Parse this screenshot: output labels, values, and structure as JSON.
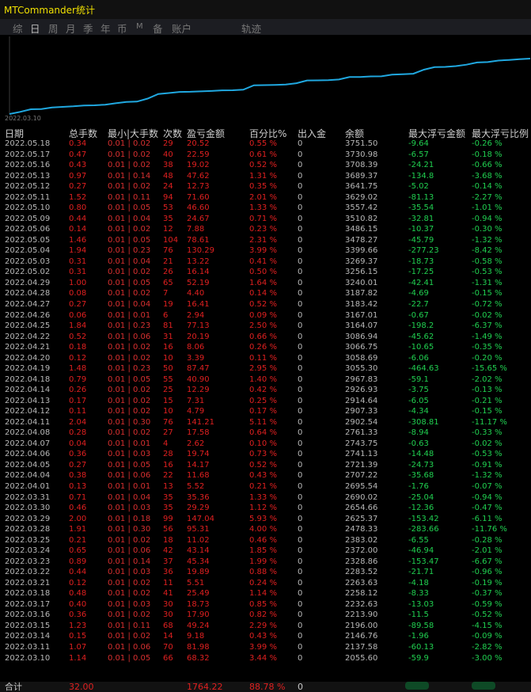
{
  "window": {
    "title": "MTCommander统计"
  },
  "tabs": [
    "综",
    "日",
    "周",
    "月",
    "季",
    "年",
    "币",
    "M",
    "备",
    "账户",
    "轨迹"
  ],
  "active_tab": "日",
  "chart": {
    "start_label": "2022.03.10",
    "line_color": "#20a8e0"
  },
  "columns": [
    "日期",
    "总手数",
    "最小|大手数",
    "次数",
    "盈亏金额",
    "百分比%",
    "出入金",
    "余额",
    "最大浮亏金额",
    "最大浮亏比例"
  ],
  "rows": [
    [
      "2022.05.18",
      "0.34",
      "0.01 | 0.02",
      "29",
      "20.52",
      "0.55 %",
      "0",
      "3751.50",
      "-9.64",
      "-0.26 %"
    ],
    [
      "2022.05.17",
      "0.47",
      "0.01 | 0.02",
      "40",
      "22.59",
      "0.61 %",
      "0",
      "3730.98",
      "-6.57",
      "-0.18 %"
    ],
    [
      "2022.05.16",
      "0.43",
      "0.01 | 0.02",
      "38",
      "19.02",
      "0.52 %",
      "0",
      "3708.39",
      "-24.21",
      "-0.66 %"
    ],
    [
      "2022.05.13",
      "0.97",
      "0.01 | 0.14",
      "48",
      "47.62",
      "1.31 %",
      "0",
      "3689.37",
      "-134.8",
      "-3.68 %"
    ],
    [
      "2022.05.12",
      "0.27",
      "0.01 | 0.02",
      "24",
      "12.73",
      "0.35 %",
      "0",
      "3641.75",
      "-5.02",
      "-0.14 %"
    ],
    [
      "2022.05.11",
      "1.52",
      "0.01 | 0.11",
      "94",
      "71.60",
      "2.01 %",
      "0",
      "3629.02",
      "-81.13",
      "-2.27 %"
    ],
    [
      "2022.05.10",
      "0.80",
      "0.01 | 0.05",
      "53",
      "46.60",
      "1.33 %",
      "0",
      "3557.42",
      "-35.54",
      "-1.01 %"
    ],
    [
      "2022.05.09",
      "0.44",
      "0.01 | 0.04",
      "35",
      "24.67",
      "0.71 %",
      "0",
      "3510.82",
      "-32.81",
      "-0.94 %"
    ],
    [
      "2022.05.06",
      "0.14",
      "0.01 | 0.02",
      "12",
      "7.88",
      "0.23 %",
      "0",
      "3486.15",
      "-10.37",
      "-0.30 %"
    ],
    [
      "2022.05.05",
      "1.46",
      "0.01 | 0.05",
      "104",
      "78.61",
      "2.31 %",
      "0",
      "3478.27",
      "-45.79",
      "-1.32 %"
    ],
    [
      "2022.05.04",
      "1.94",
      "0.01 | 0.23",
      "76",
      "130.29",
      "3.99 %",
      "0",
      "3399.66",
      "-277.23",
      "-8.42 %"
    ],
    [
      "2022.05.03",
      "0.31",
      "0.01 | 0.04",
      "21",
      "13.22",
      "0.41 %",
      "0",
      "3269.37",
      "-18.73",
      "-0.58 %"
    ],
    [
      "2022.05.02",
      "0.31",
      "0.01 | 0.02",
      "26",
      "16.14",
      "0.50 %",
      "0",
      "3256.15",
      "-17.25",
      "-0.53 %"
    ],
    [
      "2022.04.29",
      "1.00",
      "0.01 | 0.05",
      "65",
      "52.19",
      "1.64 %",
      "0",
      "3240.01",
      "-42.41",
      "-1.31 %"
    ],
    [
      "2022.04.28",
      "0.08",
      "0.01 | 0.02",
      "7",
      "4.40",
      "0.14 %",
      "0",
      "3187.82",
      "-4.69",
      "-0.15 %"
    ],
    [
      "2022.04.27",
      "0.27",
      "0.01 | 0.04",
      "19",
      "16.41",
      "0.52 %",
      "0",
      "3183.42",
      "-22.7",
      "-0.72 %"
    ],
    [
      "2022.04.26",
      "0.06",
      "0.01 | 0.01",
      "6",
      "2.94",
      "0.09 %",
      "0",
      "3167.01",
      "-0.67",
      "-0.02 %"
    ],
    [
      "2022.04.25",
      "1.84",
      "0.01 | 0.23",
      "81",
      "77.13",
      "2.50 %",
      "0",
      "3164.07",
      "-198.2",
      "-6.37 %"
    ],
    [
      "2022.04.22",
      "0.52",
      "0.01 | 0.06",
      "31",
      "20.19",
      "0.66 %",
      "0",
      "3086.94",
      "-45.62",
      "-1.49 %"
    ],
    [
      "2022.04.21",
      "0.18",
      "0.01 | 0.02",
      "16",
      "8.06",
      "0.26 %",
      "0",
      "3066.75",
      "-10.65",
      "-0.35 %"
    ],
    [
      "2022.04.20",
      "0.12",
      "0.01 | 0.02",
      "10",
      "3.39",
      "0.11 %",
      "0",
      "3058.69",
      "-6.06",
      "-0.20 %"
    ],
    [
      "2022.04.19",
      "1.48",
      "0.01 | 0.23",
      "50",
      "87.47",
      "2.95 %",
      "0",
      "3055.30",
      "-464.63",
      "-15.65 %"
    ],
    [
      "2022.04.18",
      "0.79",
      "0.01 | 0.05",
      "55",
      "40.90",
      "1.40 %",
      "0",
      "2967.83",
      "-59.1",
      "-2.02 %"
    ],
    [
      "2022.04.14",
      "0.26",
      "0.01 | 0.02",
      "25",
      "12.29",
      "0.42 %",
      "0",
      "2926.93",
      "-3.75",
      "-0.13 %"
    ],
    [
      "2022.04.13",
      "0.17",
      "0.01 | 0.02",
      "15",
      "7.31",
      "0.25 %",
      "0",
      "2914.64",
      "-6.05",
      "-0.21 %"
    ],
    [
      "2022.04.12",
      "0.11",
      "0.01 | 0.02",
      "10",
      "4.79",
      "0.17 %",
      "0",
      "2907.33",
      "-4.34",
      "-0.15 %"
    ],
    [
      "2022.04.11",
      "2.04",
      "0.01 | 0.30",
      "76",
      "141.21",
      "5.11 %",
      "0",
      "2902.54",
      "-308.81",
      "-11.17 %"
    ],
    [
      "2022.04.08",
      "0.28",
      "0.01 | 0.02",
      "27",
      "17.58",
      "0.64 %",
      "0",
      "2761.33",
      "-8.94",
      "-0.33 %"
    ],
    [
      "2022.04.07",
      "0.04",
      "0.01 | 0.01",
      "4",
      "2.62",
      "0.10 %",
      "0",
      "2743.75",
      "-0.63",
      "-0.02 %"
    ],
    [
      "2022.04.06",
      "0.36",
      "0.01 | 0.03",
      "28",
      "19.74",
      "0.73 %",
      "0",
      "2741.13",
      "-14.48",
      "-0.53 %"
    ],
    [
      "2022.04.05",
      "0.27",
      "0.01 | 0.05",
      "16",
      "14.17",
      "0.52 %",
      "0",
      "2721.39",
      "-24.73",
      "-0.91 %"
    ],
    [
      "2022.04.04",
      "0.38",
      "0.01 | 0.06",
      "22",
      "11.68",
      "0.43 %",
      "0",
      "2707.22",
      "-35.68",
      "-1.32 %"
    ],
    [
      "2022.04.01",
      "0.13",
      "0.01 | 0.01",
      "13",
      "5.52",
      "0.21 %",
      "0",
      "2695.54",
      "-1.76",
      "-0.07 %"
    ],
    [
      "2022.03.31",
      "0.71",
      "0.01 | 0.04",
      "35",
      "35.36",
      "1.33 %",
      "0",
      "2690.02",
      "-25.04",
      "-0.94 %"
    ],
    [
      "2022.03.30",
      "0.46",
      "0.01 | 0.03",
      "35",
      "29.29",
      "1.12 %",
      "0",
      "2654.66",
      "-12.36",
      "-0.47 %"
    ],
    [
      "2022.03.29",
      "2.00",
      "0.01 | 0.18",
      "99",
      "147.04",
      "5.93 %",
      "0",
      "2625.37",
      "-153.42",
      "-6.11 %"
    ],
    [
      "2022.03.28",
      "1.91",
      "0.01 | 0.30",
      "56",
      "95.31",
      "4.00 %",
      "0",
      "2478.33",
      "-283.66",
      "-11.76 %"
    ],
    [
      "2022.03.25",
      "0.21",
      "0.01 | 0.02",
      "18",
      "11.02",
      "0.46 %",
      "0",
      "2383.02",
      "-6.55",
      "-0.28 %"
    ],
    [
      "2022.03.24",
      "0.65",
      "0.01 | 0.06",
      "42",
      "43.14",
      "1.85 %",
      "0",
      "2372.00",
      "-46.94",
      "-2.01 %"
    ],
    [
      "2022.03.23",
      "0.89",
      "0.01 | 0.14",
      "37",
      "45.34",
      "1.99 %",
      "0",
      "2328.86",
      "-153.47",
      "-6.67 %"
    ],
    [
      "2022.03.22",
      "0.44",
      "0.01 | 0.03",
      "36",
      "19.89",
      "0.88 %",
      "0",
      "2283.52",
      "-21.71",
      "-0.96 %"
    ],
    [
      "2022.03.21",
      "0.12",
      "0.01 | 0.02",
      "11",
      "5.51",
      "0.24 %",
      "0",
      "2263.63",
      "-4.18",
      "-0.19 %"
    ],
    [
      "2022.03.18",
      "0.48",
      "0.01 | 0.02",
      "41",
      "25.49",
      "1.14 %",
      "0",
      "2258.12",
      "-8.33",
      "-0.37 %"
    ],
    [
      "2022.03.17",
      "0.40",
      "0.01 | 0.03",
      "30",
      "18.73",
      "0.85 %",
      "0",
      "2232.63",
      "-13.03",
      "-0.59 %"
    ],
    [
      "2022.03.16",
      "0.36",
      "0.01 | 0.02",
      "30",
      "17.90",
      "0.82 %",
      "0",
      "2213.90",
      "-11.5",
      "-0.52 %"
    ],
    [
      "2022.03.15",
      "1.23",
      "0.01 | 0.11",
      "68",
      "49.24",
      "2.29 %",
      "0",
      "2196.00",
      "-89.58",
      "-4.15 %"
    ],
    [
      "2022.03.14",
      "0.15",
      "0.01 | 0.02",
      "14",
      "9.18",
      "0.43 %",
      "0",
      "2146.76",
      "-1.96",
      "-0.09 %"
    ],
    [
      "2022.03.11",
      "1.07",
      "0.01 | 0.06",
      "70",
      "81.98",
      "3.99 %",
      "0",
      "2137.58",
      "-60.13",
      "-2.82 %"
    ],
    [
      "2022.03.10",
      "1.14",
      "0.01 | 0.05",
      "66",
      "68.32",
      "3.44 %",
      "0",
      "2055.60",
      "-59.9",
      "-3.00 %"
    ]
  ],
  "totals": {
    "label": "合计",
    "lots": "32.00",
    "pnl": "1764.22",
    "pct": "88.78 %",
    "io": "0"
  }
}
